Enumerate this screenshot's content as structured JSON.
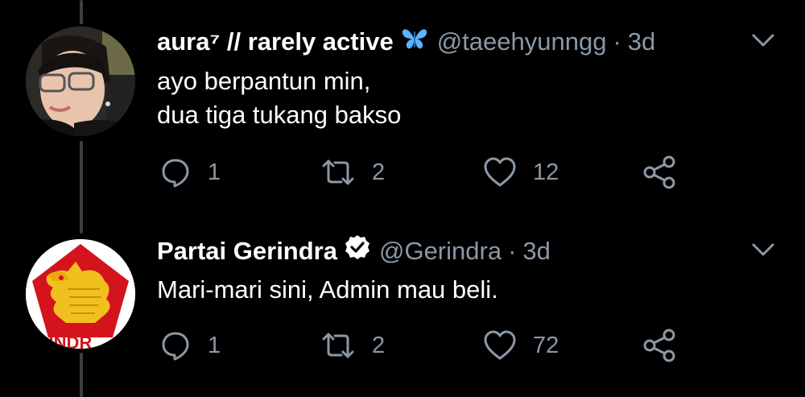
{
  "tweets": [
    {
      "display_name": "aura⁷ // rarely active",
      "badge": "butterfly-emoji-icon",
      "handle": "@taeehyunngg",
      "separator": "·",
      "time": "3d",
      "lines": [
        "ayo berpantun min,",
        "dua tiga tukang bakso"
      ],
      "replies": "1",
      "retweets": "2",
      "likes": "12"
    },
    {
      "display_name": "Partai Gerindra",
      "badge": "verified-badge-icon",
      "handle": "@Gerindra",
      "separator": "·",
      "time": "3d",
      "lines": [
        "Mari-mari sini, Admin mau beli."
      ],
      "replies": "1",
      "retweets": "2",
      "likes": "72",
      "avatar_logo_text": "GERINDRA"
    }
  ],
  "colors": {
    "background": "#000000",
    "text_primary": "#ffffff",
    "text_secondary": "#8b98a5",
    "thread_line": "#3a3f44",
    "verified": "#ffffff",
    "butterfly": "#5ab4ff",
    "gerindra_red": "#d4141c",
    "gerindra_gold": "#f2c01e"
  }
}
